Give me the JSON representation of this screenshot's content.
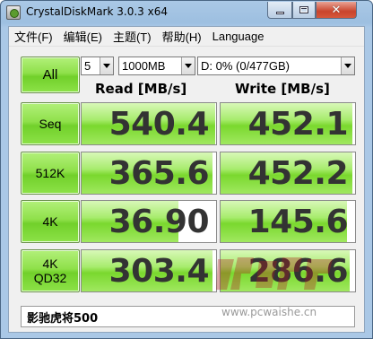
{
  "window": {
    "title": "CrystalDiskMark 3.0.3 x64"
  },
  "menu": {
    "items": [
      "文件(F)",
      "编辑(E)",
      "主题(T)",
      "帮助(H)",
      "Language"
    ]
  },
  "controls": {
    "all_label": "All",
    "runs_value": "5",
    "size_value": "1000MB",
    "drive_value": "D: 0% (0/477GB)"
  },
  "columns": {
    "read": "Read [MB/s]",
    "write": "Write [MB/s]"
  },
  "rows": [
    {
      "label": "Seq",
      "read": "540.4",
      "write": "452.1"
    },
    {
      "label": "512K",
      "read": "365.6",
      "write": "452.2"
    },
    {
      "label": "4K",
      "read": "36.90",
      "write": "145.6"
    },
    {
      "label_line1": "4K",
      "label_line2": "QD32",
      "read": "303.4",
      "write": "286.6"
    }
  ],
  "bar_levels": {
    "note": "fraction of cell filled by green bar",
    "seq_read": 0.99,
    "seq_write": 0.98,
    "k512_read": 0.97,
    "k512_write": 0.98,
    "k4_read": 0.72,
    "k4_write": 0.94,
    "qd32_read": 0.97,
    "qd32_write": 0.96
  },
  "status": {
    "text": "影驰虎将500"
  },
  "watermark": {
    "url": "www.pcwaishe.cn"
  },
  "colors": {
    "accent_green": "#8fe04a",
    "value_text": "#333333",
    "window_frame": "#aac8e6",
    "close_red": "#c9442c"
  },
  "icons": [
    "app-icon",
    "minimize-icon",
    "maximize-icon",
    "close-icon",
    "dropdown-arrow-icon"
  ]
}
